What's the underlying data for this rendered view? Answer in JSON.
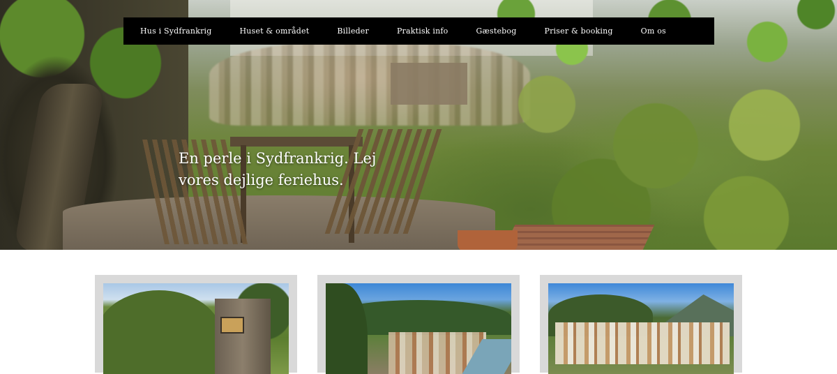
{
  "nav": {
    "items": [
      {
        "label": "Hus i Sydfrankrig"
      },
      {
        "label": "Huset & området"
      },
      {
        "label": "Billeder"
      },
      {
        "label": "Praktisk info"
      },
      {
        "label": "Gæstebog"
      },
      {
        "label": "Priser & booking"
      },
      {
        "label": "Om os"
      }
    ]
  },
  "hero": {
    "caption": "En perle i Sydfrankrig. Lej vores dejlige feriehus."
  },
  "colors": {
    "nav_background": "#000000",
    "nav_text": "#ffffff",
    "card_frame": "#d9d9d9"
  }
}
